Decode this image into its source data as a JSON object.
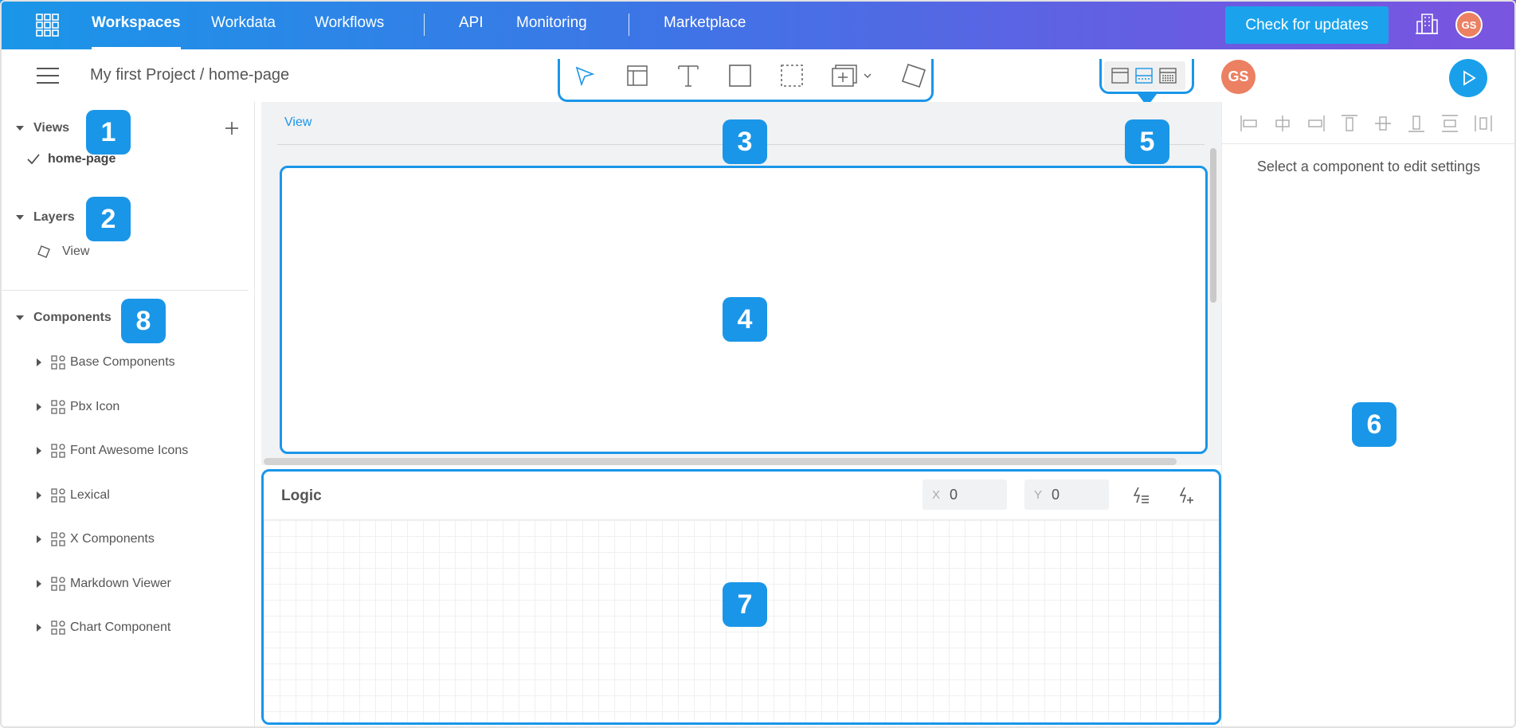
{
  "topnav": {
    "items": [
      {
        "label": "Workspaces",
        "active": true
      },
      {
        "label": "Workdata"
      },
      {
        "label": "Workflows"
      },
      {
        "label": "API"
      },
      {
        "label": "Monitoring"
      },
      {
        "label": "Marketplace"
      }
    ],
    "update_button": "Check for updates",
    "avatar_initials": "GS"
  },
  "toolbar": {
    "breadcrumb": "My first Project / home-page",
    "avatar_initials": "GS",
    "tools": [
      "select-tool",
      "layout-tool",
      "text-tool",
      "rectangle-tool",
      "marquee-tool",
      "add-component-tool",
      "shape-tool"
    ]
  },
  "sidebar": {
    "views_title": "Views",
    "views": [
      {
        "label": "home-page"
      }
    ],
    "layers_title": "Layers",
    "layers": [
      {
        "label": "View"
      }
    ],
    "components_title": "Components",
    "components": [
      {
        "label": "Base Components"
      },
      {
        "label": "Pbx Icon"
      },
      {
        "label": "Font Awesome Icons"
      },
      {
        "label": "Lexical"
      },
      {
        "label": "X Components"
      },
      {
        "label": "Markdown Viewer"
      },
      {
        "label": "Chart Component"
      }
    ]
  },
  "canvas": {
    "view_label": "View"
  },
  "right_panel": {
    "message": "Select a component to edit settings"
  },
  "logic": {
    "title": "Logic",
    "x_label": "X",
    "x_value": "0",
    "y_label": "Y",
    "y_value": "0"
  },
  "badges": [
    "1",
    "2",
    "3",
    "4",
    "5",
    "6",
    "7",
    "8"
  ],
  "colors": {
    "accent": "#1a96e8",
    "nav_gradient_start": "#1a96e8",
    "nav_gradient_end": "#7a55e0",
    "avatar": "#ec8062"
  }
}
